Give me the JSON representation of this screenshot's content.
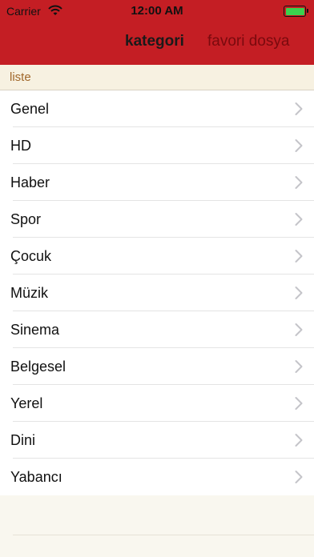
{
  "status": {
    "carrier": "Carrier",
    "time": "12:00 AM"
  },
  "nav": {
    "tab_active": "kategori",
    "tab_inactive": "favori dosya"
  },
  "section": {
    "title": "liste"
  },
  "categories": [
    {
      "label": "Genel"
    },
    {
      "label": "HD"
    },
    {
      "label": "Haber"
    },
    {
      "label": "Spor"
    },
    {
      "label": "Çocuk"
    },
    {
      "label": "Müzik"
    },
    {
      "label": "Sinema"
    },
    {
      "label": "Belgesel"
    },
    {
      "label": "Yerel"
    },
    {
      "label": "Dini"
    },
    {
      "label": "Yabancı"
    }
  ],
  "colors": {
    "header": "#c41e24",
    "section_text": "#a0672a",
    "battery": "#3ad24e"
  }
}
